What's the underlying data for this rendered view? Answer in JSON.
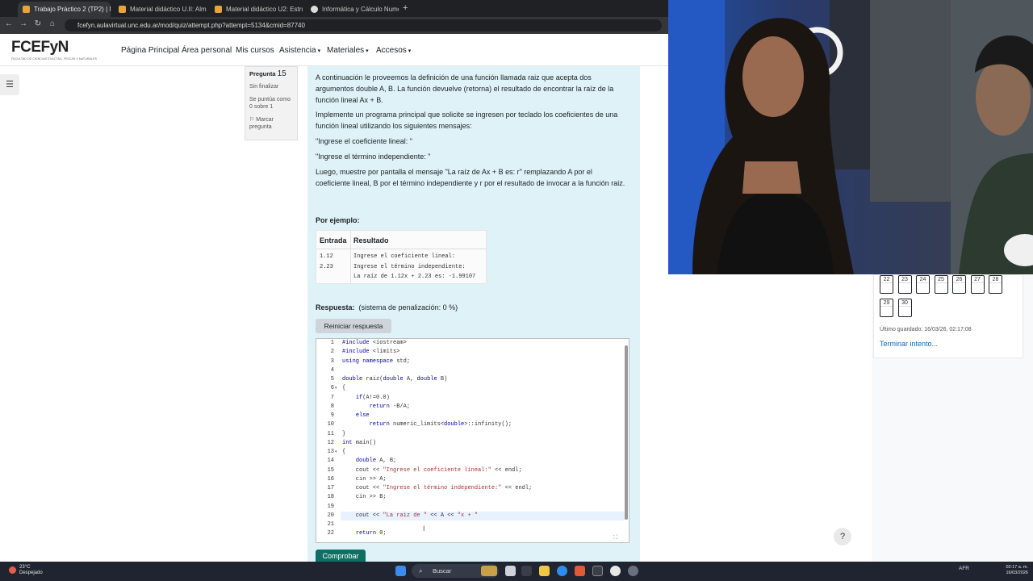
{
  "browser": {
    "tabs": [
      {
        "title": "Trabajo Práctico 2 (TP2) | NVA",
        "color": "#e8a33a",
        "active": true
      },
      {
        "title": "Material didáctico U.II: Almacen",
        "color": "#e8a33a",
        "active": false
      },
      {
        "title": "Material didáctico U2: Estructu",
        "color": "#e8a33a",
        "active": false
      },
      {
        "title": "Informática y Cálculo Numéric",
        "color": "#dddddd",
        "active": false
      }
    ],
    "url": "fcefyn.aulavirtual.unc.edu.ar/mod/quiz/attempt.php?attempt=5134&cmid=87740"
  },
  "header": {
    "logo": "FCEFyN",
    "logo_sub": "FACULTAD DE CIENCIAS EXACTAS, FÍSICAS Y NATURALES",
    "nav": [
      "Página Principal",
      "Área personal",
      "Mis cursos",
      "Asistencia",
      "Materiales",
      "Accesos"
    ]
  },
  "question_info": {
    "label": "Pregunta",
    "number": "15",
    "status": "Sin finalizar",
    "grade": "Se puntúa como 0 sobre 1",
    "flag": "Marcar pregunta"
  },
  "question": {
    "p1": "A continuación le proveemos la definición de una función llamada raiz que acepta dos argumentos double A, B. La función devuelve (retorna) el resultado de encontrar la raíz de la función lineal Ax + B.",
    "p2": "Implemente un programa principal que solicite se ingresen por teclado los coeficientes de una función lineal utilizando los siguientes mensajes:",
    "p3": "\"Ingrese el coeficiente lineal: \"",
    "p4": "\"Ingrese el término independiente: \"",
    "p5": "Luego, muestre por pantalla el mensaje \"La raíz de Ax + B es: r\" remplazando A por el coeficiente lineal, B por el término independiente y r por el resultado de invocar a la función raiz.",
    "example_label": "Por ejemplo:",
    "table_headers": [
      "Entrada",
      "Resultado"
    ],
    "table_input": "1.12\n2.23",
    "table_output": "Ingrese el coeficiente lineal:\nIngrese el término independiente:\nLa raíz de 1.12x + 2.23 es: -1.99107",
    "answer_label": "Respuesta:",
    "penalty": "(sistema de penalización: 0 %)",
    "reset_button": "Reiniciar respuesta",
    "check_button": "Comprobar"
  },
  "code_lines": [
    "#include <iostream>",
    "#include <limits>",
    "using namespace std;",
    "",
    "double raiz(double A, double B)",
    "{",
    "    if(A!=0.0)",
    "        return -B/A;",
    "    else",
    "        return numeric_limits<double>::infinity();",
    "}",
    "int main()",
    "{",
    "    double A, B;",
    "    cout << \"Ingrese el coeficiente lineal:\" << endl;",
    "    cin >> A;",
    "    cout << \"Ingrese el término independiente:\" << endl;",
    "    cin >> B;",
    "",
    "    cout << \"La raiz de \" << A << \"x + \"",
    "",
    "    return 0;"
  ],
  "quiz_nav": {
    "row1": [
      "22",
      "23",
      "24",
      "25",
      "26",
      "27",
      "28"
    ],
    "row2": [
      "29",
      "30"
    ],
    "saved": "Último guardado: 16/03/26, 02:17:08",
    "finish": "Terminar intento..."
  },
  "help": "?",
  "taskbar": {
    "temp": "23°C",
    "weather": "Despejado",
    "search": "Buscar",
    "lang": "AFR",
    "time": "02:17 a. m.",
    "date": "16/03/2026"
  }
}
